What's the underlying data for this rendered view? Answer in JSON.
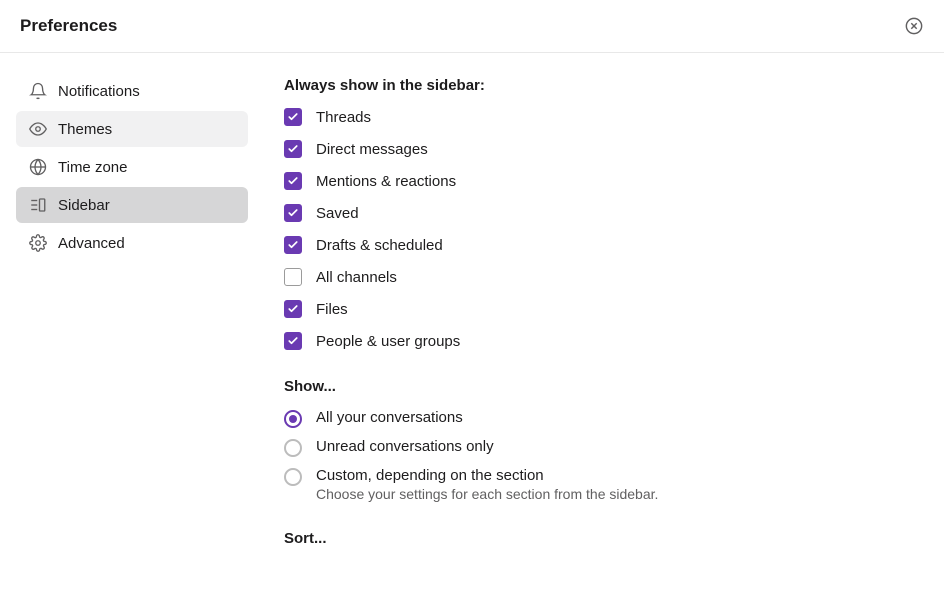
{
  "header": {
    "title": "Preferences"
  },
  "nav": {
    "items": [
      {
        "label": "Notifications",
        "icon": "bell"
      },
      {
        "label": "Themes",
        "icon": "eye"
      },
      {
        "label": "Time zone",
        "icon": "globe"
      },
      {
        "label": "Sidebar",
        "icon": "sidebar"
      },
      {
        "label": "Advanced",
        "icon": "gear"
      }
    ],
    "activeIndex": 3,
    "hoverIndex": 1
  },
  "content": {
    "alwaysShow": {
      "heading": "Always show in the sidebar:",
      "items": [
        {
          "label": "Threads",
          "checked": true
        },
        {
          "label": "Direct messages",
          "checked": true
        },
        {
          "label": "Mentions & reactions",
          "checked": true
        },
        {
          "label": "Saved",
          "checked": true
        },
        {
          "label": "Drafts & scheduled",
          "checked": true
        },
        {
          "label": "All channels",
          "checked": false
        },
        {
          "label": "Files",
          "checked": true
        },
        {
          "label": "People & user groups",
          "checked": true
        }
      ]
    },
    "show": {
      "heading": "Show...",
      "options": [
        {
          "label": "All your conversations",
          "selected": true
        },
        {
          "label": "Unread conversations only",
          "selected": false
        },
        {
          "label": "Custom, depending on the section",
          "selected": false,
          "description": "Choose your settings for each section from the sidebar."
        }
      ]
    },
    "sort": {
      "heading": "Sort..."
    }
  }
}
